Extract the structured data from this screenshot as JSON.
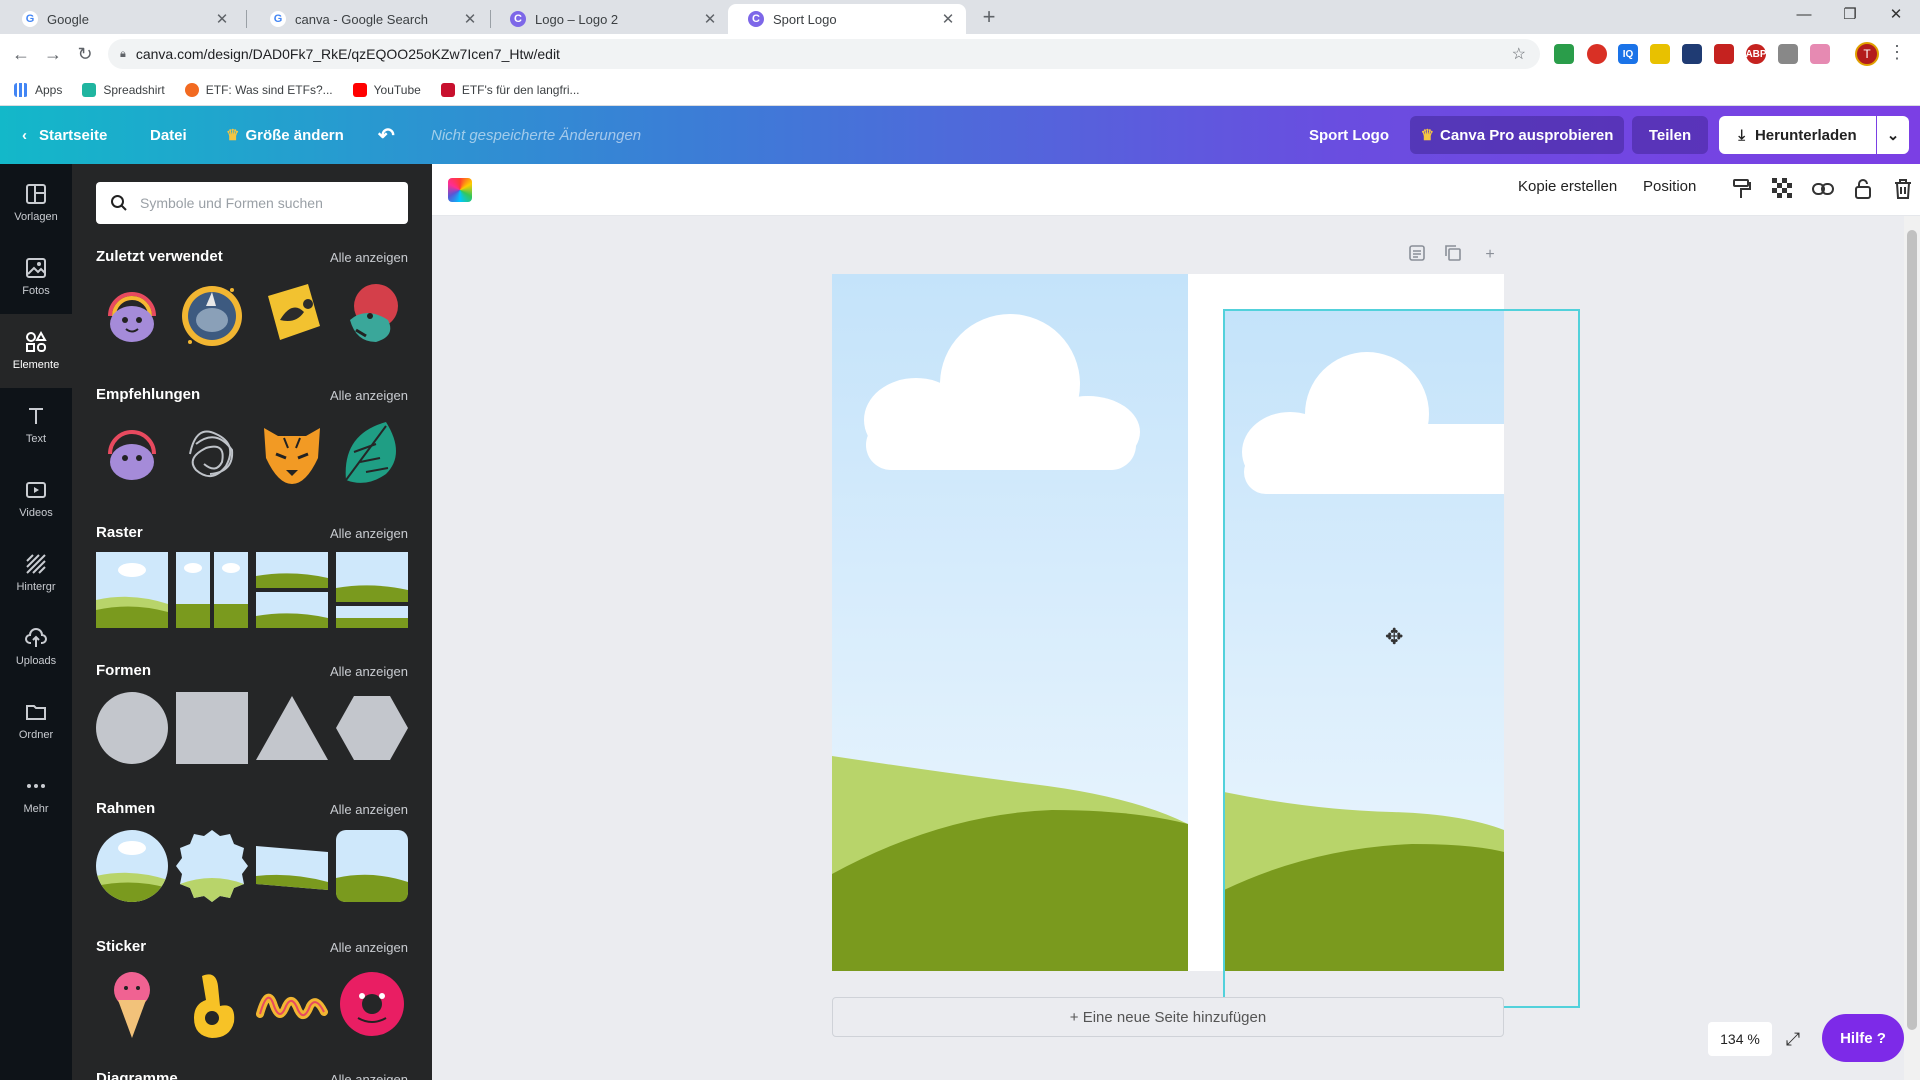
{
  "browser": {
    "tabs": [
      {
        "label": "Google",
        "favicon": "G"
      },
      {
        "label": "canva - Google Search",
        "favicon": "G"
      },
      {
        "label": "Logo – Logo 2",
        "favicon": "C"
      },
      {
        "label": "Sport Logo",
        "favicon": "C"
      }
    ],
    "url": "canva.com/design/DAD0Fk7_RkE/qzEQOO25oKZw7Icen7_Htw/edit",
    "profile_initial": "T",
    "bookmarks": [
      {
        "label": "Apps"
      },
      {
        "label": "Spreadshirt"
      },
      {
        "label": "ETF: Was sind ETFs?..."
      },
      {
        "label": "YouTube"
      },
      {
        "label": "ETF's für den langfri..."
      }
    ]
  },
  "header": {
    "home": "Startseite",
    "file": "Datei",
    "resize": "Größe ändern",
    "unsaved": "Nicht gespeicherte Änderungen",
    "design_name": "Sport Logo",
    "pro": "Canva Pro ausprobieren",
    "share": "Teilen",
    "download": "Herunterladen"
  },
  "rail": [
    {
      "label": "Vorlagen",
      "icon": "templates-icon"
    },
    {
      "label": "Fotos",
      "icon": "photos-icon"
    },
    {
      "label": "Elemente",
      "icon": "elements-icon"
    },
    {
      "label": "Text",
      "icon": "text-icon"
    },
    {
      "label": "Videos",
      "icon": "videos-icon"
    },
    {
      "label": "Hintergr",
      "icon": "background-icon"
    },
    {
      "label": "Uploads",
      "icon": "uploads-icon"
    },
    {
      "label": "Ordner",
      "icon": "folder-icon"
    },
    {
      "label": "Mehr",
      "icon": "more-icon"
    }
  ],
  "panel": {
    "search_placeholder": "Symbole und Formen suchen",
    "see_all": "Alle anzeigen",
    "sections": [
      {
        "title": "Zuletzt verwendet"
      },
      {
        "title": "Empfehlungen"
      },
      {
        "title": "Raster"
      },
      {
        "title": "Formen"
      },
      {
        "title": "Rahmen"
      },
      {
        "title": "Sticker"
      },
      {
        "title": "Diagramme"
      }
    ]
  },
  "context_toolbar": {
    "copy": "Kopie erstellen",
    "position": "Position"
  },
  "canvas": {
    "add_page": "+ Eine neue Seite hinzufügen",
    "zoom": "134 %",
    "help": "Hilfe ?"
  },
  "colors": {
    "accent": "#7d2ae8",
    "selection": "#52d1db",
    "panel_bg": "#252627",
    "rail_bg": "#0e1318",
    "sky": "#cfe8fb",
    "grass": "#7a9a1e",
    "grass_light": "#b8d46a"
  }
}
